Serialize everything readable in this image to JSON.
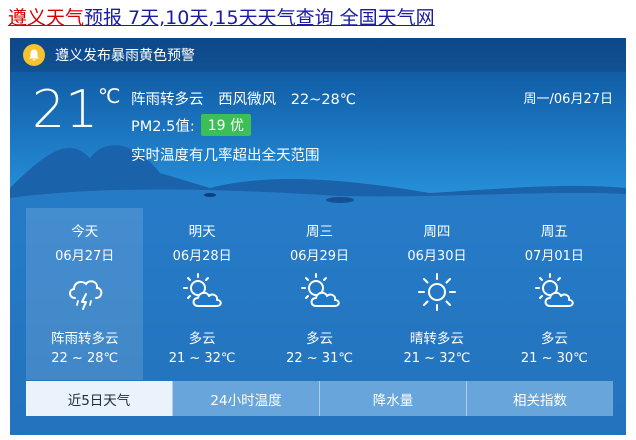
{
  "title": {
    "city_link": "遵义天气",
    "rest": "预报 7天,10天,15天天气查询 全国天气网"
  },
  "alert": {
    "text": "遵义发布暴雨黄色预警",
    "icon": "bell-icon",
    "icon_color": "#f6c22d"
  },
  "current": {
    "temperature": "21",
    "unit": "℃",
    "condition": "阵雨转多云",
    "wind": "西风微风",
    "range": "22~28℃",
    "date": "周一/06月27日",
    "pm_label": "PM2.5值:",
    "pm_value": "19 优",
    "pm_color": "#3cbf56",
    "note": "实时温度有几率超出全天范围"
  },
  "forecast": [
    {
      "day": "今天",
      "date": "06月27日",
      "icon": "thunder-rain-icon",
      "condition": "阵雨转多云",
      "temp": "22 ~ 28℃"
    },
    {
      "day": "明天",
      "date": "06月28日",
      "icon": "partly-cloudy-icon",
      "condition": "多云",
      "temp": "21 ~ 32℃"
    },
    {
      "day": "周三",
      "date": "06月29日",
      "icon": "partly-cloudy-icon",
      "condition": "多云",
      "temp": "22 ~ 31℃"
    },
    {
      "day": "周四",
      "date": "06月30日",
      "icon": "sun-icon",
      "condition": "晴转多云",
      "temp": "21 ~ 32℃"
    },
    {
      "day": "周五",
      "date": "07月01日",
      "icon": "partly-cloudy-icon",
      "condition": "多云",
      "temp": "21 ~ 30℃"
    }
  ],
  "tabs": [
    "近5日天气",
    "24小时温度",
    "降水量",
    "相关指数"
  ]
}
